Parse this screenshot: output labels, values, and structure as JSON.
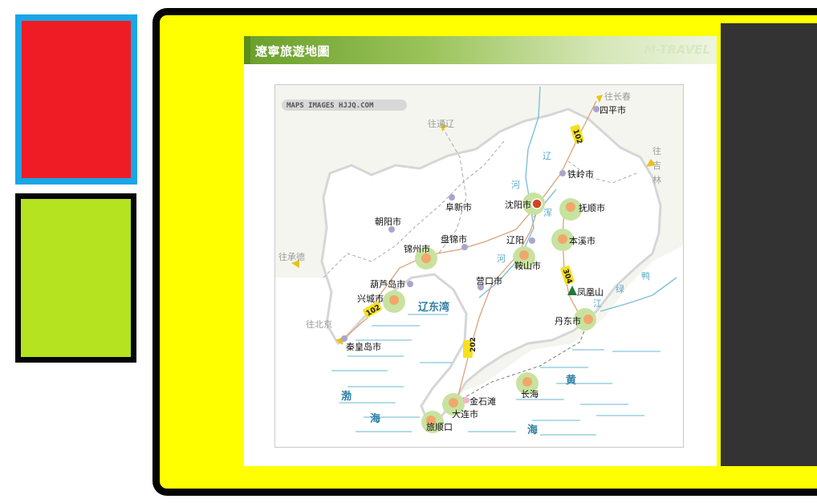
{
  "colors": {
    "swatch_1_fill": "#ef1c26",
    "swatch_1_border": "#19a6e8",
    "swatch_2_fill": "#b5e31f",
    "swatch_2_border": "#050505",
    "frame_fill": "#ffff00",
    "side_panel": "#333333",
    "header_green": "#6a9f2a"
  },
  "header": {
    "title": "遼寧旅遊地圖",
    "brand": "M-TRAVEL"
  },
  "map": {
    "watermark": "MAPS IMAGES HJJQ.COM",
    "cities": {
      "shenyang": "沈阳市",
      "fushun": "抚顺市",
      "benxi": "本溪市",
      "tieling": "铁岭市",
      "siping": "四平市",
      "fuxin": "阜新市",
      "chaoyang": "朝阳市",
      "jinzhou": "锦州市",
      "panjin": "盘锦市",
      "liaoyang": "辽阳",
      "anshan": "鞍山市",
      "yingkou": "营口市",
      "huludao": "葫芦岛市",
      "xingcheng": "兴城市",
      "qinhuangdao": "秦皇岛市",
      "dandong": "丹东市",
      "fenghuangshan": "凤凰山",
      "jinshitan": "金石滩",
      "dalian": "大连市",
      "lushunkou": "旅顺口",
      "changhai": "长海"
    },
    "directions": {
      "changchun": "往长春",
      "tongliao": "往通辽",
      "jilin_1": "往",
      "jilin_2": "吉",
      "jilin_3": "林",
      "chengde": "往承德",
      "beijing": "往北京"
    },
    "water": {
      "bay": "辽东湾",
      "bohai_1": "渤",
      "bohai_2": "海",
      "yellow_1": "黄",
      "yellow_2": "海"
    },
    "rivers": {
      "liao_1": "辽",
      "liao_2": "河",
      "hun_1": "浑",
      "hun_2": "河",
      "yalu_1": "鸭",
      "yalu_2": "绿",
      "yalu_3": "江"
    },
    "roads": {
      "r102_north": "102",
      "r102_west": "102",
      "r304": "304",
      "r202": "202"
    }
  }
}
